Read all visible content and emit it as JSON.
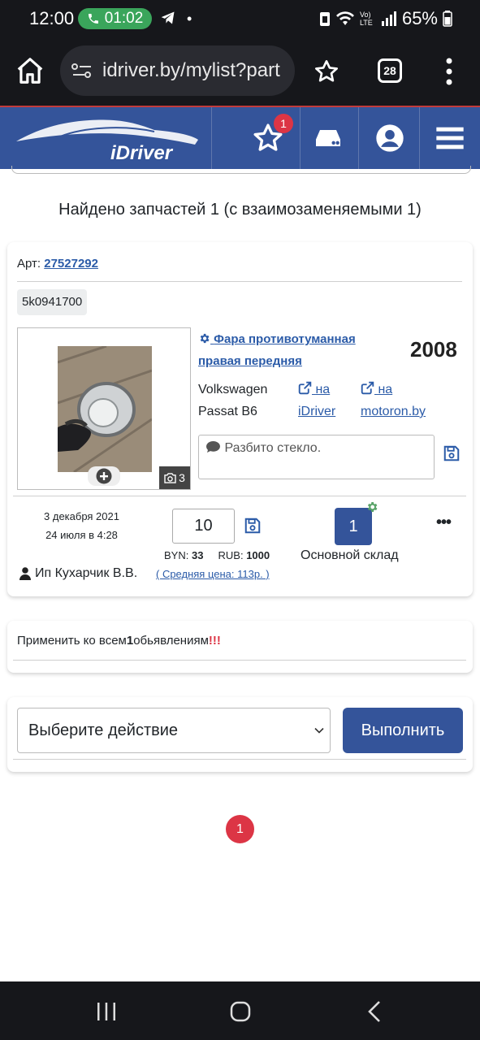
{
  "status": {
    "time": "12:00",
    "call_timer": "01:02",
    "battery": "65%",
    "net": "Vo) LTE"
  },
  "browser": {
    "url": "idriver.by/mylist?part",
    "tabs_count": "28"
  },
  "nav": {
    "logo_text": "iDriver",
    "fav_badge": "1"
  },
  "summary": {
    "found_text": "Найдено запчастей 1 (с взаимозаменяемыми 1)"
  },
  "part": {
    "art_label": "Арт:",
    "art_number": "27527292",
    "oem": "5k0941700",
    "photo_count": "3",
    "title_line1": "Фара противотуманная",
    "title_line2": "правая передняя",
    "year": "2008",
    "make": "Volkswagen",
    "model": "Passat B6",
    "link1_a": "на",
    "link1_b": "iDriver",
    "link2_a": "на",
    "link2_b": "motoron.by",
    "note": "Разбито стекло.",
    "date_created": "3 декабря 2021",
    "date_updated": "24 июля в 4:28",
    "quantity": "10",
    "byn_label": "BYN:",
    "byn_value": "33",
    "rub_label": "RUB:",
    "rub_value": "1000",
    "avg_price": "( Средняя цена: 113р. )",
    "warehouse_count": "1",
    "warehouse_name": "Основной склад",
    "seller": "Ип Кухарчик В.В."
  },
  "apply": {
    "prefix": "Применить ко всем",
    "count": "1",
    "suffix": "обьявлениям",
    "exclaim": "!!!"
  },
  "bulk": {
    "select_value": "Выберите действие",
    "execute_label": "Выполнить"
  },
  "pagination": {
    "current": "1"
  },
  "colors": {
    "brand": "#34549a",
    "link": "#2b5ba8",
    "danger": "#dc3545"
  }
}
